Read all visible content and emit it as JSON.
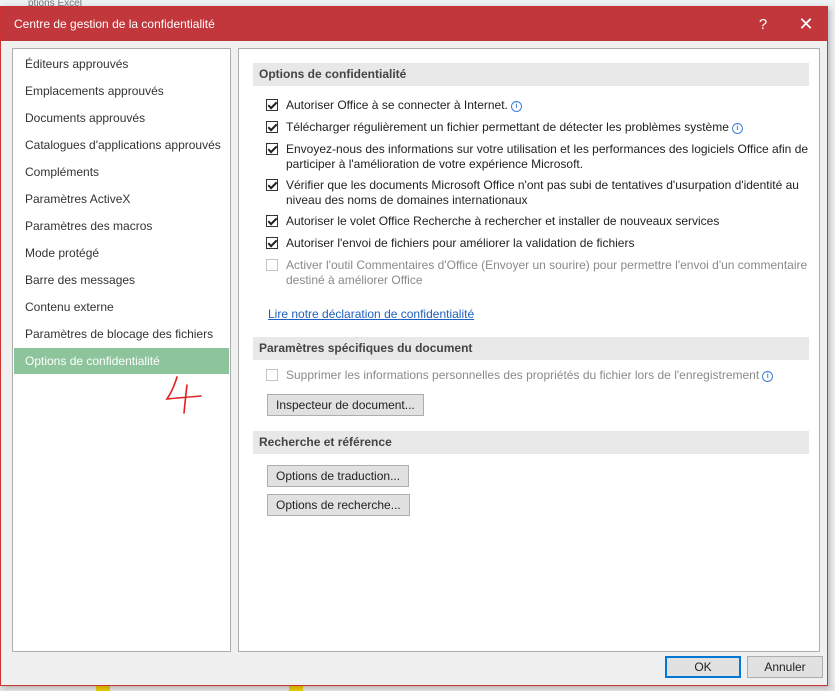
{
  "background": {
    "excel_title_fragment": "ptions Excel"
  },
  "dialog": {
    "title": "Centre de gestion de la confidentialité",
    "help_label": "?",
    "close_label": "✕"
  },
  "nav": {
    "items": [
      {
        "label": "Éditeurs approuvés"
      },
      {
        "label": "Emplacements approuvés"
      },
      {
        "label": "Documents approuvés"
      },
      {
        "label": "Catalogues d'applications approuvés"
      },
      {
        "label": "Compléments"
      },
      {
        "label": "Paramètres ActiveX"
      },
      {
        "label": "Paramètres des macros"
      },
      {
        "label": "Mode protégé"
      },
      {
        "label": "Barre des messages"
      },
      {
        "label": "Contenu externe"
      },
      {
        "label": "Paramètres de blocage des fichiers"
      },
      {
        "label": "Options de confidentialité",
        "selected": true
      }
    ],
    "annotation": "4"
  },
  "privacy": {
    "header": "Options de confidentialité",
    "options": [
      {
        "label": "Autoriser Office à se connecter à Internet.",
        "checked": true,
        "info": true
      },
      {
        "label": "Télécharger régulièrement un fichier permettant de détecter les problèmes système",
        "checked": true,
        "info": true
      },
      {
        "label": "Envoyez-nous des informations sur votre utilisation et les performances des logiciels Office afin de participer à l'amélioration de votre expérience Microsoft.",
        "checked": true
      },
      {
        "label": "Vérifier que les documents Microsoft Office n'ont pas subi de tentatives d'usurpation d'identité au niveau des noms de domaines internationaux",
        "checked": true
      },
      {
        "label": "Autoriser le volet Office Recherche à rechercher et installer de nouveaux services",
        "checked": true
      },
      {
        "label": "Autoriser l'envoi de fichiers pour améliorer la validation de fichiers",
        "checked": true
      },
      {
        "label": "Activer l'outil Commentaires d'Office (Envoyer un sourire) pour permettre l'envoi d'un commentaire destiné à améliorer Office",
        "checked": false,
        "disabled": true
      }
    ],
    "link": "Lire notre déclaration de confidentialité"
  },
  "document_settings": {
    "header": "Paramètres spécifiques du document",
    "option": {
      "label": "Supprimer les informations personnelles des propriétés du fichier lors de l'enregistrement",
      "checked": false,
      "disabled": true,
      "info": true
    },
    "inspector_button": "Inspecteur de document..."
  },
  "research": {
    "header": "Recherche et référence",
    "translation_button": "Options de traduction...",
    "research_button": "Options de recherche..."
  },
  "footer": {
    "ok": "OK",
    "cancel": "Annuler"
  },
  "colors": {
    "title_bar": "#c1373b",
    "selected_nav": "#8dc49b",
    "link": "#1f5fbf",
    "annotation": "#e02020"
  }
}
